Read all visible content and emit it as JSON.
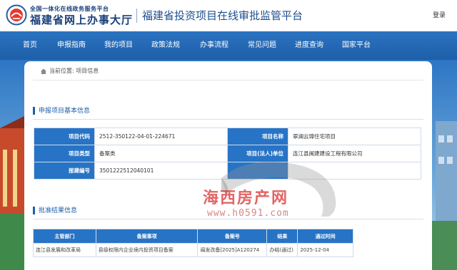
{
  "header": {
    "logo_line1": "全国一体化在线政务服务平台",
    "logo_line2": "福建省网上办事大厅",
    "platform_title": "福建省投资项目在线审批监管平台",
    "login": "登录"
  },
  "nav": [
    "首页",
    "申报指南",
    "我的项目",
    "政策法规",
    "办事流程",
    "常见问题",
    "进度查询",
    "国家平台"
  ],
  "breadcrumb": {
    "prefix": "当前位置:",
    "current": "项目信息"
  },
  "basic_info": {
    "title": "申报项目基本信息",
    "rows": [
      {
        "label1": "项目代码",
        "value1": "2512-350122-04-01-224671",
        "label2": "项目名称",
        "value2": "翠澜云璋住宅项目"
      },
      {
        "label1": "项目类型",
        "value1": "备案类",
        "label2": "项目(法人)单位",
        "value2": "连江县闽建建设工程有限公司"
      },
      {
        "label1": "报建编号",
        "value1": "3501222512040101",
        "label2": "",
        "value2": ""
      }
    ]
  },
  "approval": {
    "title": "批准结果信息",
    "headers": [
      "主管部门",
      "备案事项",
      "备案号",
      "结果",
      "通过时间"
    ],
    "rows": [
      [
        "连江县发展和改革局",
        "县级权限内企业境内投资项目备案",
        "闽发改备[2025]A120274",
        "办结(通过)",
        "2025-12-04"
      ]
    ]
  },
  "watermark": {
    "title": "海西房产网",
    "url": "www.h0591.com"
  },
  "colors": {
    "brand_blue": "#1e5fa8",
    "table_header": "#2774c6",
    "watermark_red": "#d72828"
  }
}
